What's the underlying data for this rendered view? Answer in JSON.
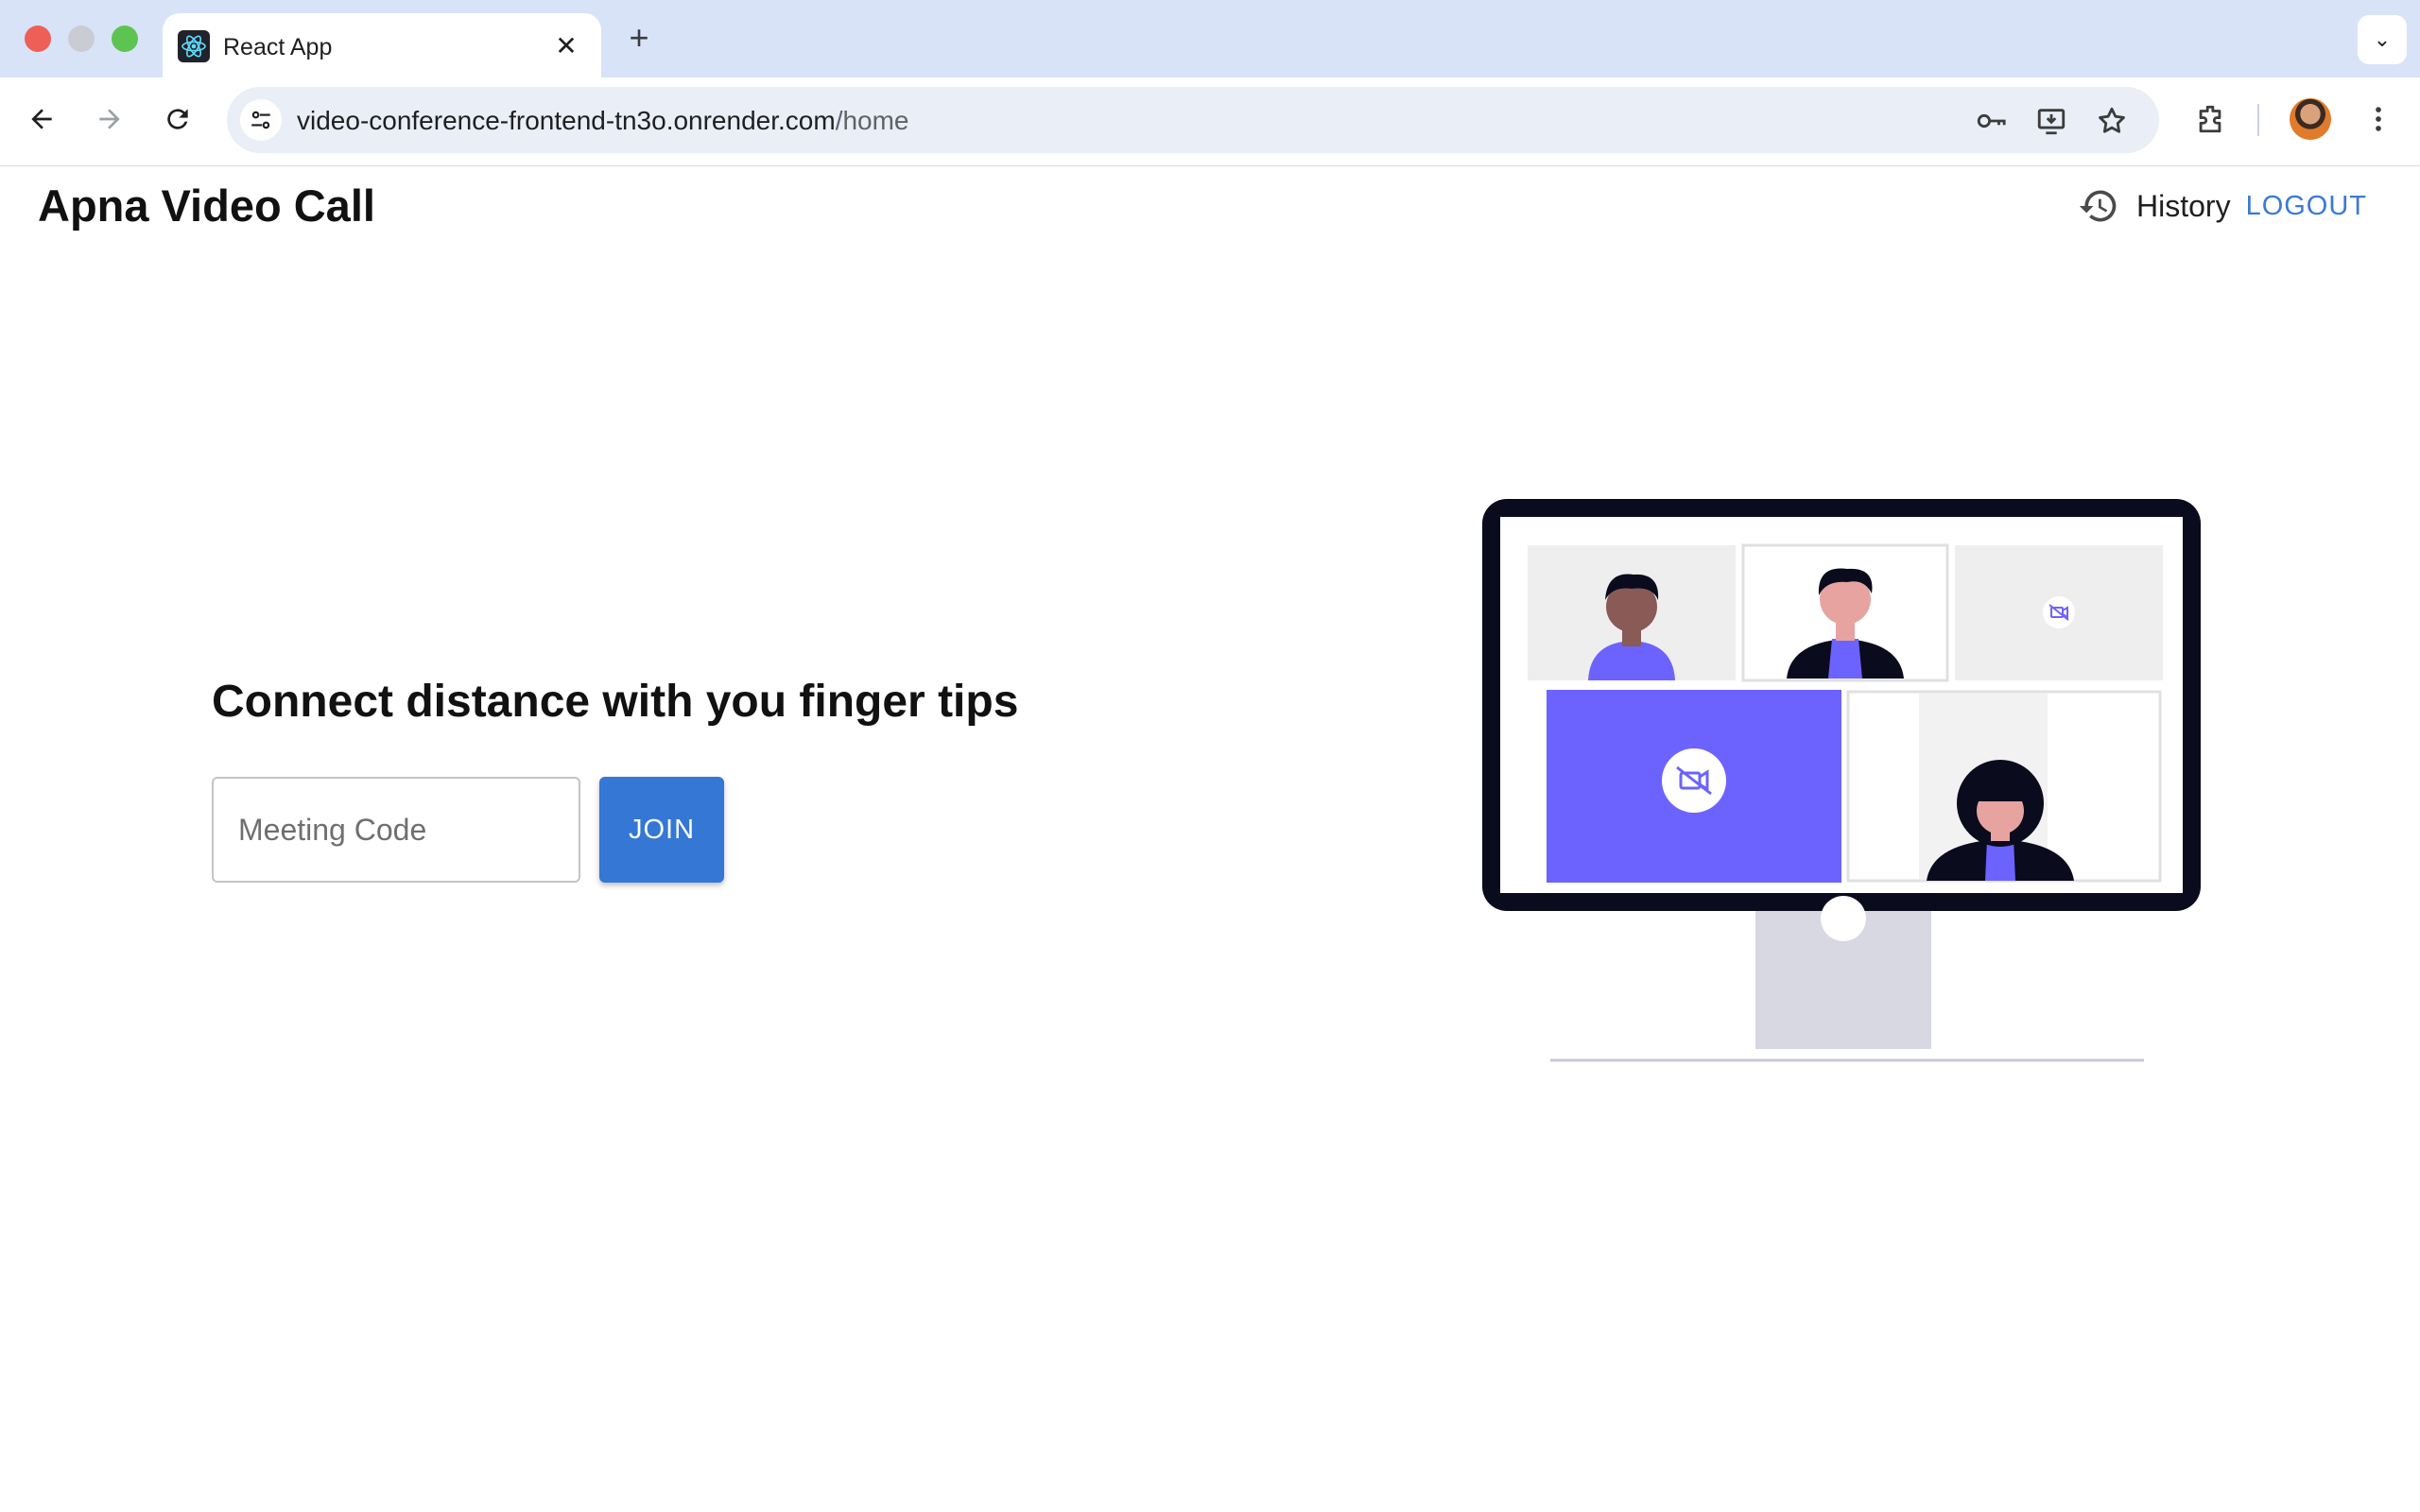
{
  "browser": {
    "tab_title": "React App",
    "tab_close": "✕",
    "new_tab": "+",
    "tab_search": "⌄",
    "url_host": "video-conference-frontend-tn3o.onrender.com",
    "url_path": "/home"
  },
  "app": {
    "title": "Apna Video Call",
    "nav": {
      "history_label": "History",
      "logout_label": "LOGOUT"
    },
    "hero": {
      "heading": "Connect distance with you finger tips",
      "input_placeholder": "Meeting Code",
      "input_value": "",
      "join_label": "JOIN"
    }
  },
  "colors": {
    "accent": "#3577d4",
    "logout": "#3a79d8",
    "illustration_purple": "#6c63ff",
    "monitor_frame": "#0b0b1e",
    "stand": "#d8d8e3"
  },
  "icons": {
    "favicon": "react-atom-icon",
    "back": "arrow-left-icon",
    "forward": "arrow-right-icon",
    "reload": "reload-icon",
    "site_info": "tune-icon",
    "key": "key-icon",
    "install": "install-app-icon",
    "bookmark": "star-icon",
    "extensions": "puzzle-icon",
    "menu": "kebab-menu-icon",
    "history": "history-icon",
    "camera_off": "video-off-icon"
  }
}
